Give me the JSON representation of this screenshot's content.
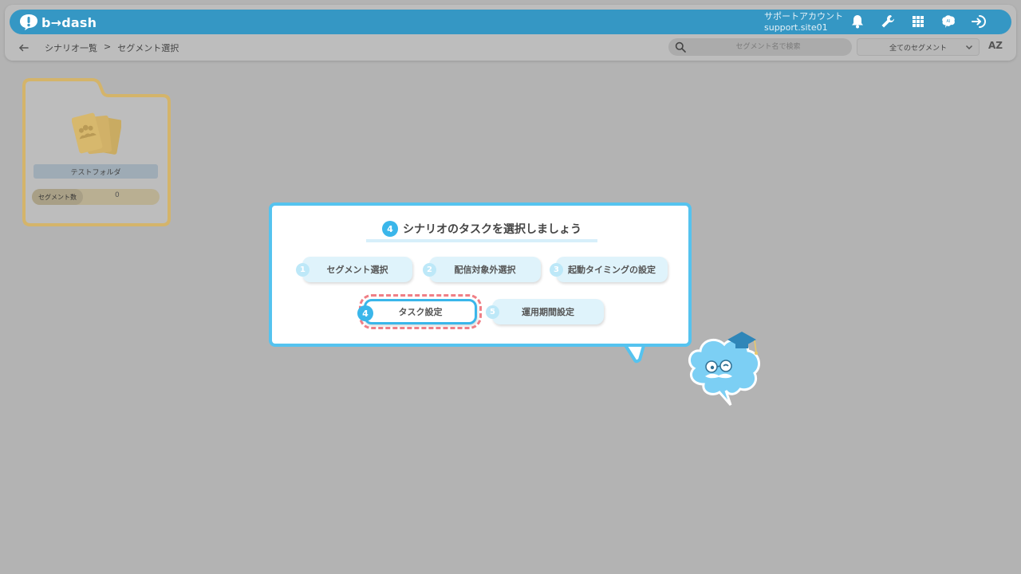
{
  "header": {
    "logo_text": "b→dash",
    "account_name": "サポートアカウント",
    "account_site": "support.site01",
    "icons": [
      "bell-icon",
      "wrench-icon",
      "grid-icon",
      "brain-icon",
      "logout-icon"
    ]
  },
  "breadcrumb": {
    "items": [
      "シナリオ一覧",
      "セグメント選択"
    ],
    "separator": ">"
  },
  "search": {
    "placeholder": "セグメント名で検索"
  },
  "filter": {
    "selected": "全てのセグメント"
  },
  "sort": {
    "label": "AZ"
  },
  "folder": {
    "name": "テストフォルダ",
    "segment_label": "セグメント数",
    "segment_count": "0"
  },
  "tutorial": {
    "step_number": "4",
    "title": "シナリオのタスクを選択しましょう",
    "steps": [
      {
        "num": "1",
        "label": "セグメント選択"
      },
      {
        "num": "2",
        "label": "配信対象外選択"
      },
      {
        "num": "3",
        "label": "起動タイミングの設定"
      },
      {
        "num": "4",
        "label": "タスク設定"
      },
      {
        "num": "5",
        "label": "運用期間設定"
      }
    ]
  },
  "colors": {
    "topbar": "#3597c4",
    "accent": "#3ab6ea",
    "highlight_dash": "#ef7f86",
    "folder_border": "#d4b46a"
  }
}
